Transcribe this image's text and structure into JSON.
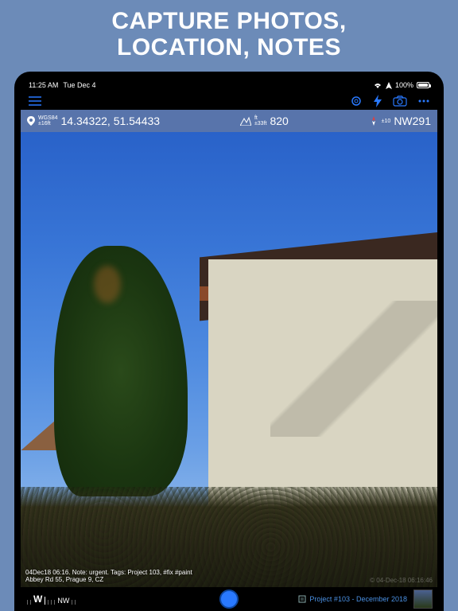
{
  "banner": {
    "line1": "CAPTURE PHOTOS,",
    "line2": "LOCATION, NOTES"
  },
  "status": {
    "time": "11:25 AM",
    "date": "Tue Dec 4",
    "battery_pct": "100%"
  },
  "info": {
    "coord_sys": "WGS84",
    "coord_acc": "±16ft",
    "coords": "14.34322, 51.54433",
    "alt_unit": "ft",
    "alt_acc": "±33ft",
    "altitude": "820",
    "heading_sub": "±10",
    "heading": "NW291"
  },
  "overlay": {
    "line1": "04Dec18 06:16. Note: urgent. Tags: Project 103, #fix #paint",
    "line2": "Abbey Rd 55, Prague 9, CZ",
    "watermark": "© 04-Dec-18 06:16:46"
  },
  "bottom": {
    "compass_major": "W",
    "compass_minor": "NW",
    "project_label": "Project #103 - December 2018"
  }
}
